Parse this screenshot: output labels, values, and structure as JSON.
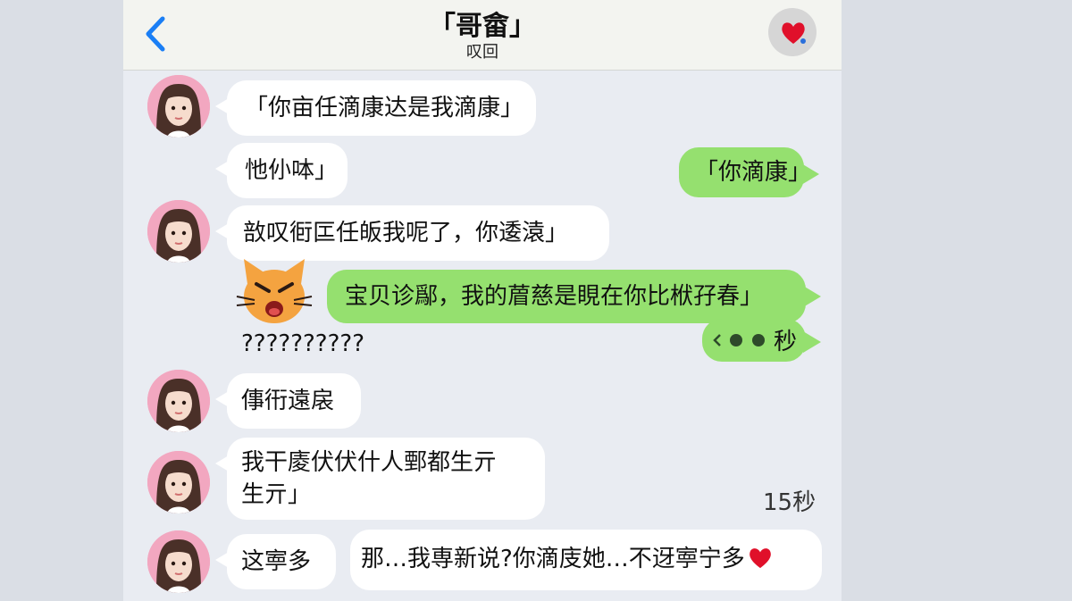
{
  "header": {
    "back_icon": "chevron-left-icon",
    "title": "「哥畲」",
    "subtitle": "叹回",
    "heart_icon": "heart-icon"
  },
  "messages": [
    {
      "side": "in",
      "text": "「你亩任滴康达是我滴康」"
    },
    {
      "side": "in",
      "text": "忚仦呠」"
    },
    {
      "side": "out",
      "text": "「你滴康」"
    },
    {
      "side": "in",
      "text": "敨叹衐匞任皈我呢了，你逶溒」"
    },
    {
      "side": "out",
      "text": "宝贝诊鄬，我的葿慈是睍在你比栿孖春」"
    },
    {
      "side": "out_voice",
      "length": "秒"
    },
    {
      "side": "plain",
      "text": "??????????"
    },
    {
      "side": "in",
      "text": "倳衎遠扆"
    },
    {
      "side": "in",
      "lines": [
        "我干庱伏伏什人鄄都生亓",
        "生亓」"
      ]
    },
    {
      "side": "timer",
      "text": "15秒"
    },
    {
      "side": "in",
      "text": "这寕多"
    },
    {
      "side": "in",
      "text": "那…我専新说?你滴庋她…不迓寕宁多"
    }
  ],
  "colors": {
    "header_bg": "#f3f4f0",
    "chat_bg": "#e9ecf2",
    "outgoing_bubble": "#95e06f",
    "incoming_bubble": "#ffffff",
    "back_arrow": "#1a7ef5",
    "heart": "#e0102a"
  },
  "icons": [
    "chevron-left-icon",
    "heart-icon",
    "voice-wave-icon",
    "angry-cat-emoji",
    "avatar"
  ]
}
